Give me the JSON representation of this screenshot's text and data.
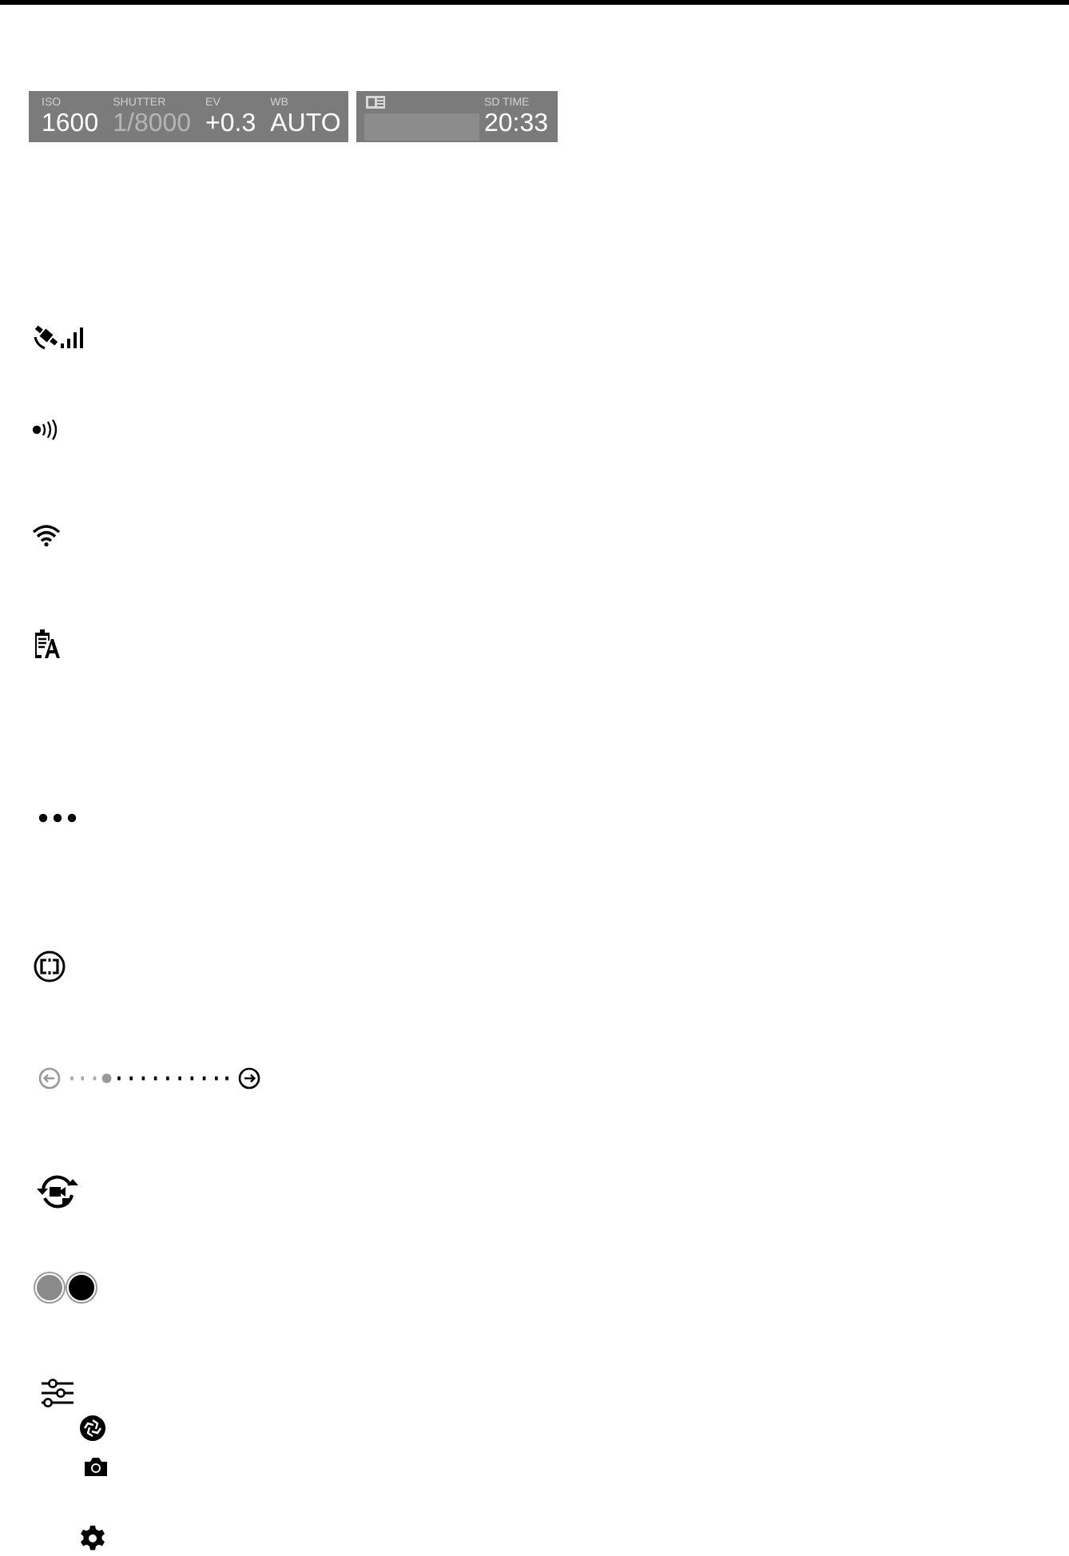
{
  "status_panel": {
    "readouts": [
      {
        "label": "ISO",
        "value": "1600",
        "disabled": false
      },
      {
        "label": "SHUTTER",
        "value": "1/8000",
        "disabled": true
      },
      {
        "label": "EV",
        "value": "+0.3",
        "disabled": false
      },
      {
        "label": "WB",
        "value": "AUTO",
        "disabled": false
      }
    ]
  },
  "card_panel": {
    "label": "SD TIME",
    "value": "20:33"
  },
  "step_slider": {
    "level": 0.23
  },
  "swatches": [
    {
      "color": "#8a8a8a"
    },
    {
      "color": "#000000"
    }
  ]
}
